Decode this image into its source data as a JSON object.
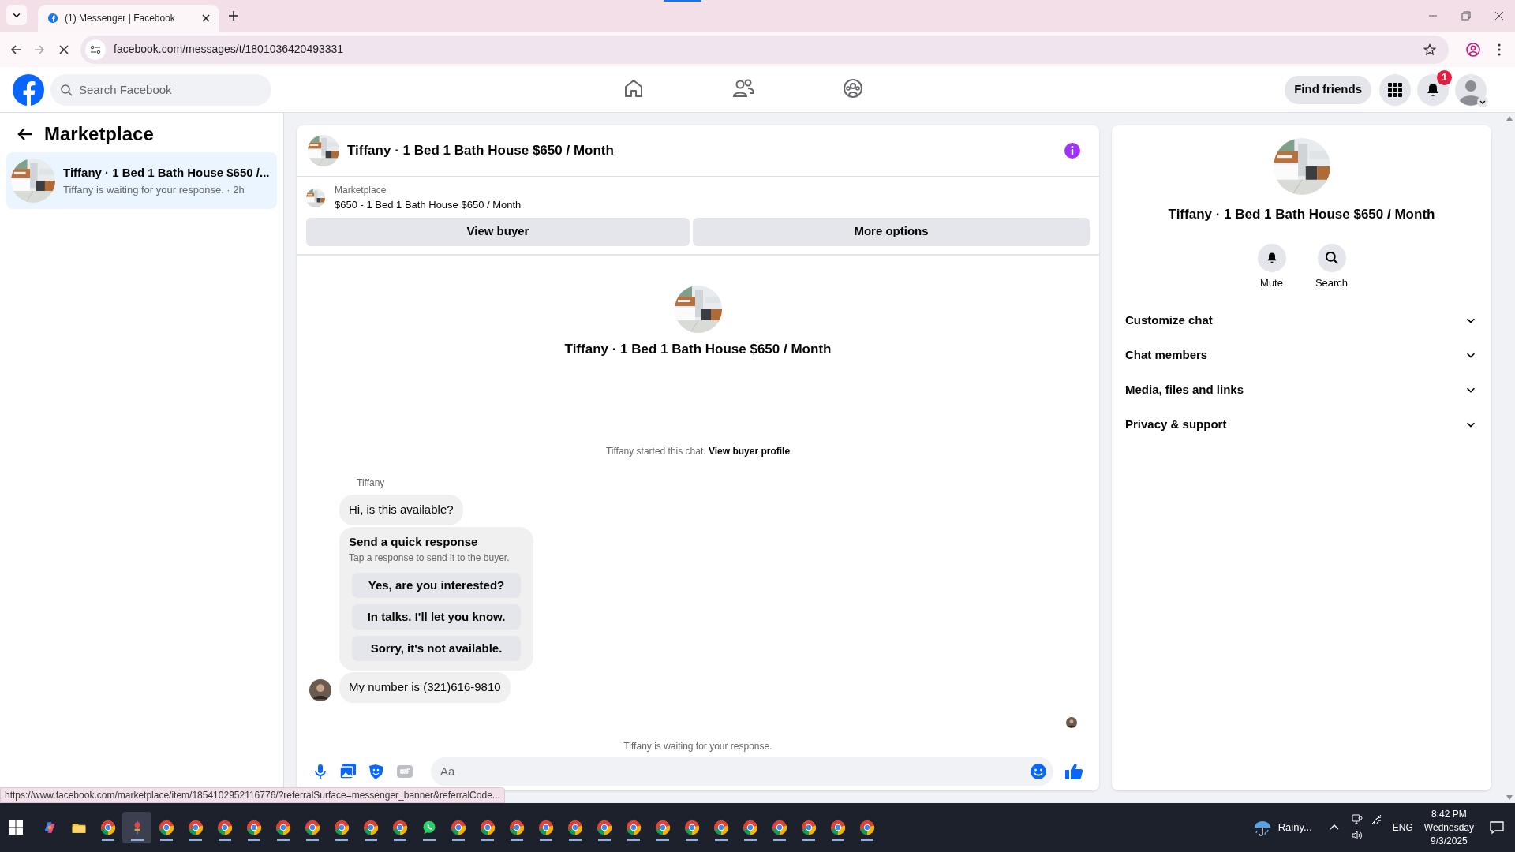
{
  "browser": {
    "tab_title": "(1) Messenger | Facebook",
    "url": "facebook.com/messages/t/1801036420493331",
    "status_url": "https://www.facebook.com/marketplace/item/1854102952116776/?referralSurface=messenger_banner&referralCode..."
  },
  "header": {
    "search_placeholder": "Search Facebook",
    "find_friends": "Find friends",
    "notification_count": "1"
  },
  "sidebar": {
    "title": "Marketplace",
    "conversations": [
      {
        "title": "Tiffany · 1 Bed 1 Bath House $650 /...",
        "preview": "Tiffany is waiting for your response. · 2h",
        "selected": true
      }
    ]
  },
  "chat": {
    "title": "Tiffany · 1 Bed 1 Bath House $650 / Month",
    "banner": {
      "label": "Marketplace",
      "listing": "$650 - 1 Bed 1 Bath House $650 / Month"
    },
    "buttons": [
      "View buyer",
      "More options"
    ],
    "intro_title": "Tiffany · 1 Bed 1 Bath House $650 / Month",
    "started_note": "Tiffany started this chat.",
    "profile_link": "View buyer profile",
    "sender": "Tiffany",
    "messages": [
      {
        "kind": "text",
        "text": "Hi, is this available?"
      },
      {
        "kind": "quick_responses",
        "title": "Send a quick response",
        "subtitle": "Tap a response to send it to the buyer.",
        "options": [
          "Yes, are you interested?",
          "In talks. I'll let you know.",
          "Sorry, it's not available."
        ]
      },
      {
        "kind": "text",
        "text": "My number is (321)616-9810"
      }
    ],
    "waiting_note": "Tiffany is waiting for your response.",
    "composer_placeholder": "Aa"
  },
  "details": {
    "title": "Tiffany · 1 Bed 1 Bath House $650 / Month",
    "actions": [
      {
        "kind": "mute",
        "label": "Mute"
      },
      {
        "kind": "search",
        "label": "Search"
      }
    ],
    "sections": [
      {
        "label": "Customize chat",
        "expanded": false
      },
      {
        "label": "Chat members",
        "expanded": false
      },
      {
        "label": "Media, files and links",
        "expanded": false
      },
      {
        "label": "Privacy & support",
        "expanded": false
      }
    ]
  },
  "taskbar": {
    "apps": [
      {
        "kind": "copilot",
        "selected": false
      },
      {
        "kind": "explorer",
        "selected": false
      },
      {
        "kind": "chrome",
        "selected": false
      },
      {
        "kind": "pinned",
        "selected": true
      },
      {
        "kind": "chrome",
        "selected": false
      },
      {
        "kind": "chrome",
        "selected": false
      },
      {
        "kind": "chrome",
        "selected": false
      },
      {
        "kind": "chrome",
        "selected": false
      },
      {
        "kind": "chrome",
        "selected": false
      },
      {
        "kind": "chrome",
        "selected": false
      },
      {
        "kind": "chrome",
        "selected": false
      },
      {
        "kind": "chrome",
        "selected": false
      },
      {
        "kind": "chrome",
        "selected": false
      },
      {
        "kind": "whatsapp",
        "selected": false
      },
      {
        "kind": "chrome",
        "selected": false
      },
      {
        "kind": "chrome",
        "selected": false
      },
      {
        "kind": "chrome",
        "selected": false
      },
      {
        "kind": "chrome",
        "selected": false
      },
      {
        "kind": "chrome",
        "selected": false
      },
      {
        "kind": "chrome",
        "selected": false
      },
      {
        "kind": "chrome",
        "selected": false
      },
      {
        "kind": "chrome",
        "selected": false
      },
      {
        "kind": "chrome",
        "selected": false
      },
      {
        "kind": "chrome",
        "selected": false
      },
      {
        "kind": "chrome",
        "selected": false
      },
      {
        "kind": "chrome",
        "selected": false
      },
      {
        "kind": "chrome",
        "selected": false
      },
      {
        "kind": "chrome",
        "selected": false
      },
      {
        "kind": "chrome",
        "selected": false
      }
    ],
    "weather": "Rainy...",
    "language": "ENG",
    "time": "8:42 PM",
    "day": "Wednesday",
    "date": "9/3/2025"
  }
}
